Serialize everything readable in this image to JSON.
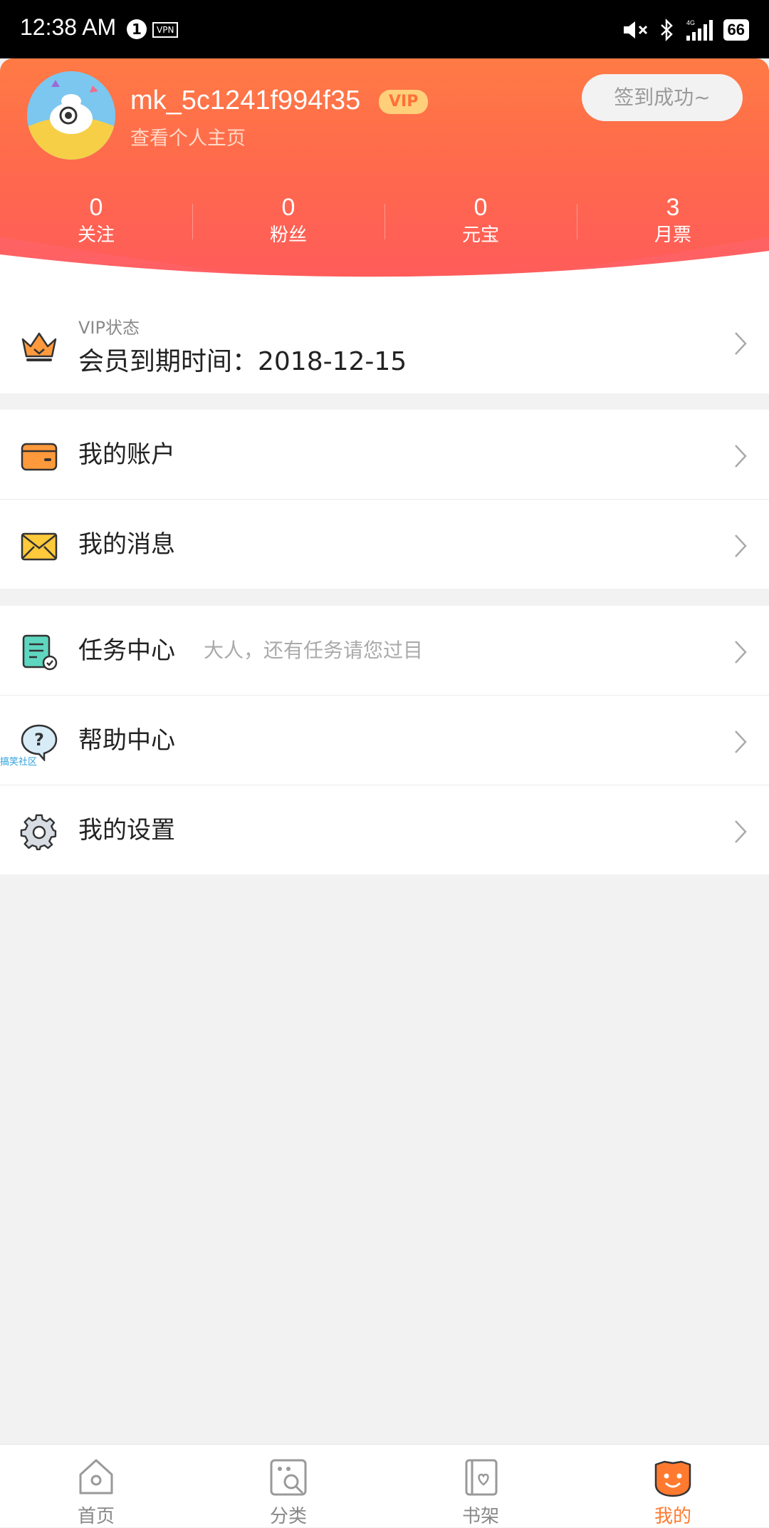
{
  "status_bar": {
    "time": "12:38 AM",
    "notification_count": "1",
    "vpn": "VPN",
    "network": "4G",
    "battery": "66"
  },
  "profile": {
    "username": "mk_5c1241f994f35",
    "vip_badge": "VIP",
    "profile_link": "查看个人主页",
    "signin_button": "签到成功~"
  },
  "stats": [
    {
      "value": "0",
      "label": "关注"
    },
    {
      "value": "0",
      "label": "粉丝"
    },
    {
      "value": "0",
      "label": "元宝"
    },
    {
      "value": "3",
      "label": "月票"
    }
  ],
  "vip": {
    "title": "VIP状态",
    "expiry": "会员到期时间：2018-12-15"
  },
  "menu": {
    "account": "我的账户",
    "messages": "我的消息",
    "tasks": "任务中心",
    "tasks_hint": "大人，还有任务请您过目",
    "help": "帮助中心",
    "settings": "我的设置"
  },
  "watermark": "搞笑社区",
  "tabs": [
    {
      "label": "首页",
      "active": false
    },
    {
      "label": "分类",
      "active": false
    },
    {
      "label": "书架",
      "active": false
    },
    {
      "label": "我的",
      "active": true
    }
  ],
  "colors": {
    "accent": "#ff7a2f",
    "header_top": "#ff7a45",
    "header_bottom": "#ff5a5c"
  }
}
